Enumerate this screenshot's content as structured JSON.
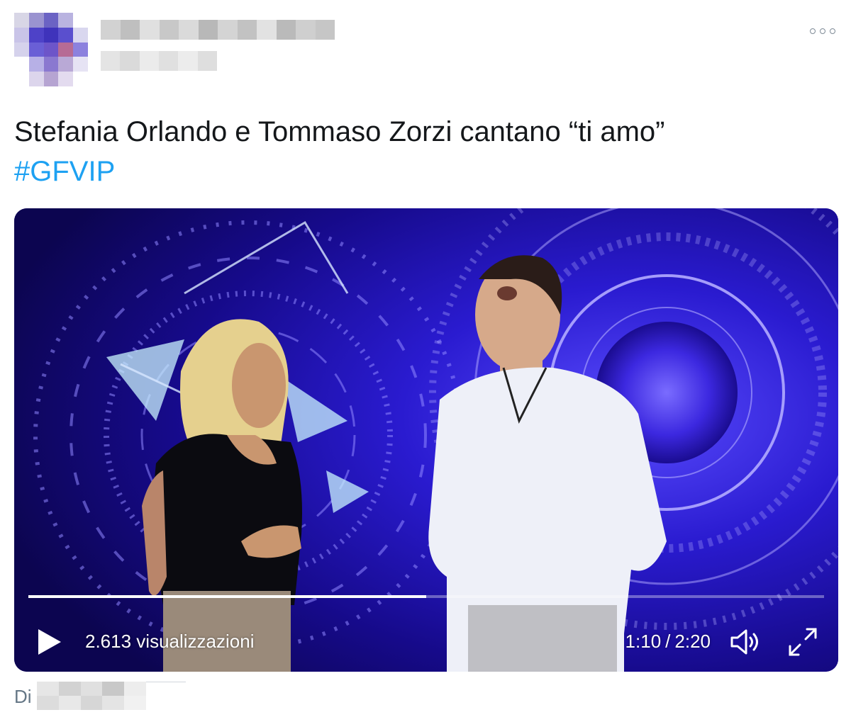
{
  "header": {
    "more_icon": "more-options-icon",
    "colors": {
      "more": "#7e8a96"
    }
  },
  "tweet": {
    "text": "Stefania Orlando e Tommaso Zorzi cantano “ti amo”",
    "hashtag": "#GFVIP",
    "colors": {
      "text": "#14171a",
      "hashtag": "#1da1f2"
    }
  },
  "video": {
    "views": "2.613 visualizzazioni",
    "current_time": "1:10",
    "separator": "/",
    "duration": "2:20",
    "progress": 0.5,
    "play_icon": "play-icon",
    "volume_icon": "volume-icon",
    "fullscreen_icon": "fullscreen-icon"
  },
  "credit": {
    "prefix": "Di"
  }
}
